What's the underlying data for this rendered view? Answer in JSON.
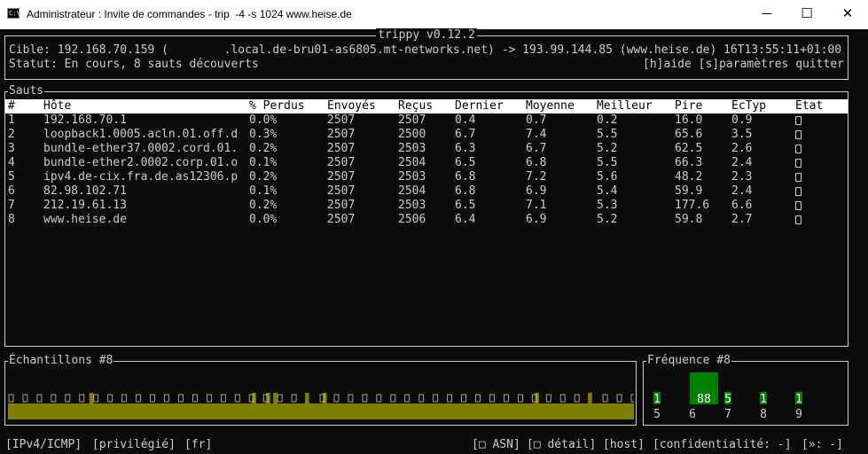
{
  "window": {
    "title": "Administrateur : Invite de commandes - trip  -4 -s 1024 www.heise.de",
    "icon": "console-icon",
    "controls": {
      "minimize": "─",
      "maximize": "☐",
      "close": "✕"
    }
  },
  "header": {
    "app_title": "trippy v0.12.2",
    "target": "Cible: 192.168.70.159 (        .local.de-bru01-as6805.mt-networks.net) -> 193.99.144.85 (www.heise.de)",
    "timestamp": "16T13:55:11+01:00",
    "status": "Statut: En cours, 8 sauts découverts",
    "help": "[h]aide [s]paramètres quitter"
  },
  "hops": {
    "title": "Sauts",
    "columns": [
      "#",
      "Hôte",
      "% Perdus",
      "Envoyés",
      "Reçus",
      "Dernier",
      "Moyenne",
      "Meilleur",
      "Pire",
      "ÉcTyp",
      "État"
    ],
    "rows": [
      [
        "1",
        "192.168.70.1",
        "0.0%",
        "2507",
        "2507",
        "0.4",
        "0.7",
        "0.2",
        "16.0",
        "0.9"
      ],
      [
        "2",
        "loopback1.0005.acln.01.off.d",
        "0.3%",
        "2507",
        "2500",
        "6.7",
        "7.4",
        "5.5",
        "65.6",
        "3.5"
      ],
      [
        "3",
        "bundle-ether37.0002.cord.01.",
        "0.2%",
        "2507",
        "2503",
        "6.3",
        "6.7",
        "5.2",
        "62.5",
        "2.6"
      ],
      [
        "4",
        "bundle-ether2.0002.corp.01.o",
        "0.1%",
        "2507",
        "2504",
        "6.5",
        "6.8",
        "5.5",
        "66.3",
        "2.4"
      ],
      [
        "5",
        "ipv4.de-cix.fra.de.as12306.p",
        "0.2%",
        "2507",
        "2503",
        "6.8",
        "7.2",
        "5.6",
        "48.2",
        "2.3"
      ],
      [
        "6",
        "82.98.102.71",
        "0.1%",
        "2507",
        "2504",
        "6.8",
        "6.9",
        "5.4",
        "59.9",
        "2.4"
      ],
      [
        "7",
        "212.19.61.13",
        "0.2%",
        "2507",
        "2503",
        "6.5",
        "7.1",
        "5.3",
        "177.6",
        "6.6"
      ],
      [
        "8",
        "www.heise.de",
        "0.0%",
        "2507",
        "2506",
        "6.4",
        "6.9",
        "5.2",
        "59.8",
        "2.7"
      ]
    ]
  },
  "samples": {
    "title": "Échantillons #8",
    "color": "#808000",
    "values": [
      1,
      1,
      1,
      1,
      1,
      1,
      1,
      1,
      1,
      1,
      1,
      1,
      1,
      1,
      1,
      1,
      1,
      1,
      1,
      1,
      1,
      1,
      1,
      2,
      1,
      1,
      1,
      1,
      1,
      1,
      1,
      1,
      1,
      1,
      1,
      1,
      1,
      1,
      1,
      1,
      1,
      1,
      1,
      1,
      1,
      1,
      1,
      1,
      1,
      1,
      1,
      1,
      1,
      1,
      1,
      1,
      1,
      1,
      1,
      1,
      1,
      1,
      1,
      1,
      1,
      1,
      1,
      1,
      1,
      2,
      1,
      1,
      1,
      2,
      1,
      2,
      1,
      1,
      1,
      1,
      1,
      1,
      1,
      1,
      2,
      1,
      1,
      1,
      1,
      2,
      1,
      1,
      1,
      1,
      1,
      1,
      1,
      1,
      1,
      1,
      1,
      1,
      1,
      1,
      1,
      1,
      1,
      1,
      1,
      1,
      1,
      1,
      1,
      1,
      1,
      1,
      1,
      1,
      1,
      1,
      1,
      1,
      1,
      1,
      1,
      1,
      1,
      1,
      1,
      1,
      1,
      1,
      1,
      1,
      1,
      1,
      1,
      1,
      1,
      1,
      1,
      1,
      1,
      1,
      1,
      1,
      1,
      1,
      1,
      2,
      1,
      1,
      1,
      1,
      1,
      1,
      1,
      1,
      1,
      1,
      1,
      1,
      1,
      1,
      2,
      1,
      1,
      1,
      1,
      1,
      1,
      1,
      1,
      1,
      1,
      1,
      1
    ],
    "markers": [
      6,
      72,
      78,
      84
    ]
  },
  "frequency": {
    "title": "Fréquence #8",
    "color": "#008000",
    "bins": [
      {
        "label": "5",
        "count": "1",
        "level": 0.15
      },
      {
        "label": "6",
        "count": "88",
        "level": 1.0
      },
      {
        "label": "7",
        "count": "5",
        "level": 0.2
      },
      {
        "label": "8",
        "count": "1",
        "level": 0.15
      },
      {
        "label": "9",
        "count": "1",
        "level": 0.15
      }
    ]
  },
  "statusbar": {
    "protocol": "[IPv4/ICMP]",
    "privilege": "[privilégié]",
    "locale": "[fr]",
    "asn": "[□ ASN]",
    "detail": "[□ détail]",
    "host": "[host]",
    "privacy": "[confidentialité: -]",
    "hops_range": "[»: -]"
  }
}
